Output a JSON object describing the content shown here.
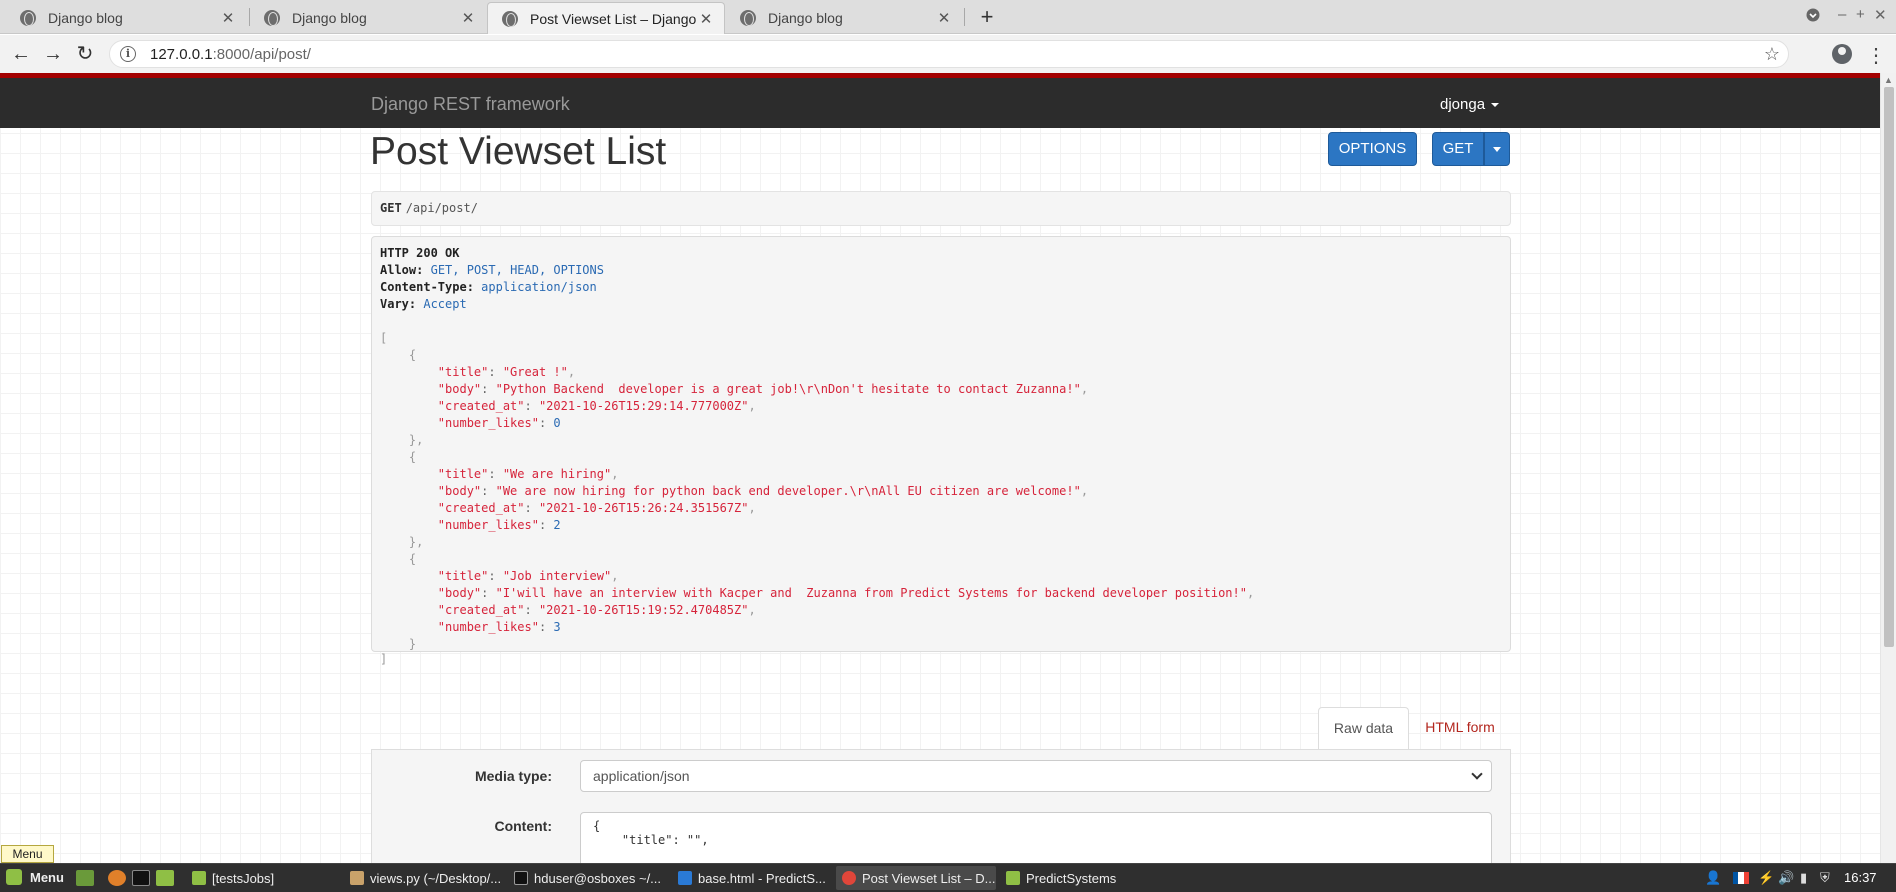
{
  "browser": {
    "tabs": [
      {
        "label": "Django blog",
        "active": false
      },
      {
        "label": "Django blog",
        "active": false
      },
      {
        "label": "Post Viewset List – Django REST",
        "active": true
      },
      {
        "label": "Django blog",
        "active": false
      }
    ],
    "url_host": "127.0.0.1",
    "url_rest": ":8000/api/post/"
  },
  "nav": {
    "brand": "Django REST framework",
    "user": "djonga"
  },
  "page": {
    "title": "Post Viewset List",
    "options_label": "OPTIONS",
    "get_label": "GET"
  },
  "request": {
    "method": "GET",
    "path": "/api/post/"
  },
  "response": {
    "status": "HTTP 200 OK",
    "headers": [
      {
        "key": "Allow:",
        "value": "GET, POST, HEAD, OPTIONS"
      },
      {
        "key": "Content-Type:",
        "value": "application/json"
      },
      {
        "key": "Vary:",
        "value": "Accept"
      }
    ],
    "posts": [
      {
        "title": "\"Great !\"",
        "body": "\"Python Backend  developer is a great job!\\r\\nDon't hesitate to contact Zuzanna!\"",
        "created_at": "\"2021-10-26T15:29:14.777000Z\"",
        "number_likes": "0"
      },
      {
        "title": "\"We are hiring\"",
        "body": "\"We are now hiring for python back end developer.\\r\\nAll EU citizen are welcome!\"",
        "created_at": "\"2021-10-26T15:26:24.351567Z\"",
        "number_likes": "2"
      },
      {
        "title": "\"Job interview\"",
        "body": "\"I'will have an interview with Kacper and  Zuzanna from Predict Systems for backend developer position!\"",
        "created_at": "\"2021-10-26T15:19:52.470485Z\"",
        "number_likes": "3"
      }
    ],
    "keys": {
      "title": "\"title\"",
      "body": "\"body\"",
      "created_at": "\"created_at\"",
      "number_likes": "\"number_likes\""
    }
  },
  "form": {
    "tab_raw": "Raw data",
    "tab_html": "HTML form",
    "media_type_label": "Media type:",
    "media_type_value": "application/json",
    "content_label": "Content:",
    "content_value": "{\n    \"title\": \"\","
  },
  "tooltip": "Menu",
  "taskbar": {
    "menu_label": "Menu",
    "tasks": [
      "[testsJobs]",
      "views.py (~/Desktop/...",
      "hduser@osboxes ~/...",
      "base.html - PredictS...",
      "Post Viewset List – D...",
      "PredictSystems"
    ],
    "clock": "16:37"
  },
  "colors": {
    "nav_bg": "#2c2c2c",
    "nav_accent": "#a30000",
    "button_primary": "#2c76c3",
    "json_string": "#d6243b",
    "json_number": "#2a6ab3"
  }
}
